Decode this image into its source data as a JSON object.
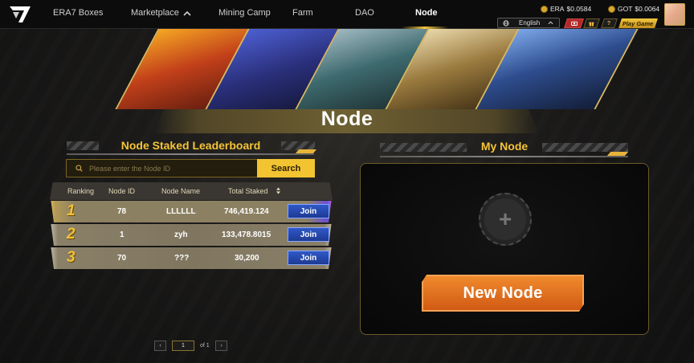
{
  "nav": {
    "items": [
      "ERA7 Boxes",
      "Marketplace",
      "Mining Camp",
      "Farm",
      "DAO",
      "Node"
    ],
    "active": "Node"
  },
  "header": {
    "prices": [
      {
        "symbol": "ERA",
        "value": "$0.0584"
      },
      {
        "symbol": "GOT",
        "value": "$0.0064"
      }
    ],
    "language": "English",
    "play_label": "Play Game",
    "icons": [
      "globe-icon",
      "chevron-up-icon",
      "camera-icon",
      "gift-icon",
      "question-icon"
    ]
  },
  "page": {
    "title": "Node"
  },
  "leaderboard": {
    "title": "Node Staked Leaderboard",
    "search_placeholder": "Please enter the Node ID",
    "search_label": "Search",
    "columns": [
      "Ranking",
      "Node ID",
      "Node Name",
      "Total Staked"
    ],
    "rows": [
      {
        "rank": "1",
        "node_id": "78",
        "name": "LLLLLL",
        "staked": "746,419.124",
        "action": "Join"
      },
      {
        "rank": "2",
        "node_id": "1",
        "name": "zyh",
        "staked": "133,478.8015",
        "action": "Join"
      },
      {
        "rank": "3",
        "node_id": "70",
        "name": "???",
        "staked": "30,200",
        "action": "Join"
      }
    ],
    "pagination": {
      "prev": "‹",
      "current": "1",
      "of_label": "of 1",
      "next": "›"
    }
  },
  "my_node": {
    "title": "My Node",
    "add_symbol": "+",
    "new_node_label": "New Node"
  },
  "colors": {
    "accent_gold": "#f2c431",
    "join_blue": "#2548b0",
    "new_node_orange": "#e8731f",
    "rank_gold": "#f0c13a"
  }
}
